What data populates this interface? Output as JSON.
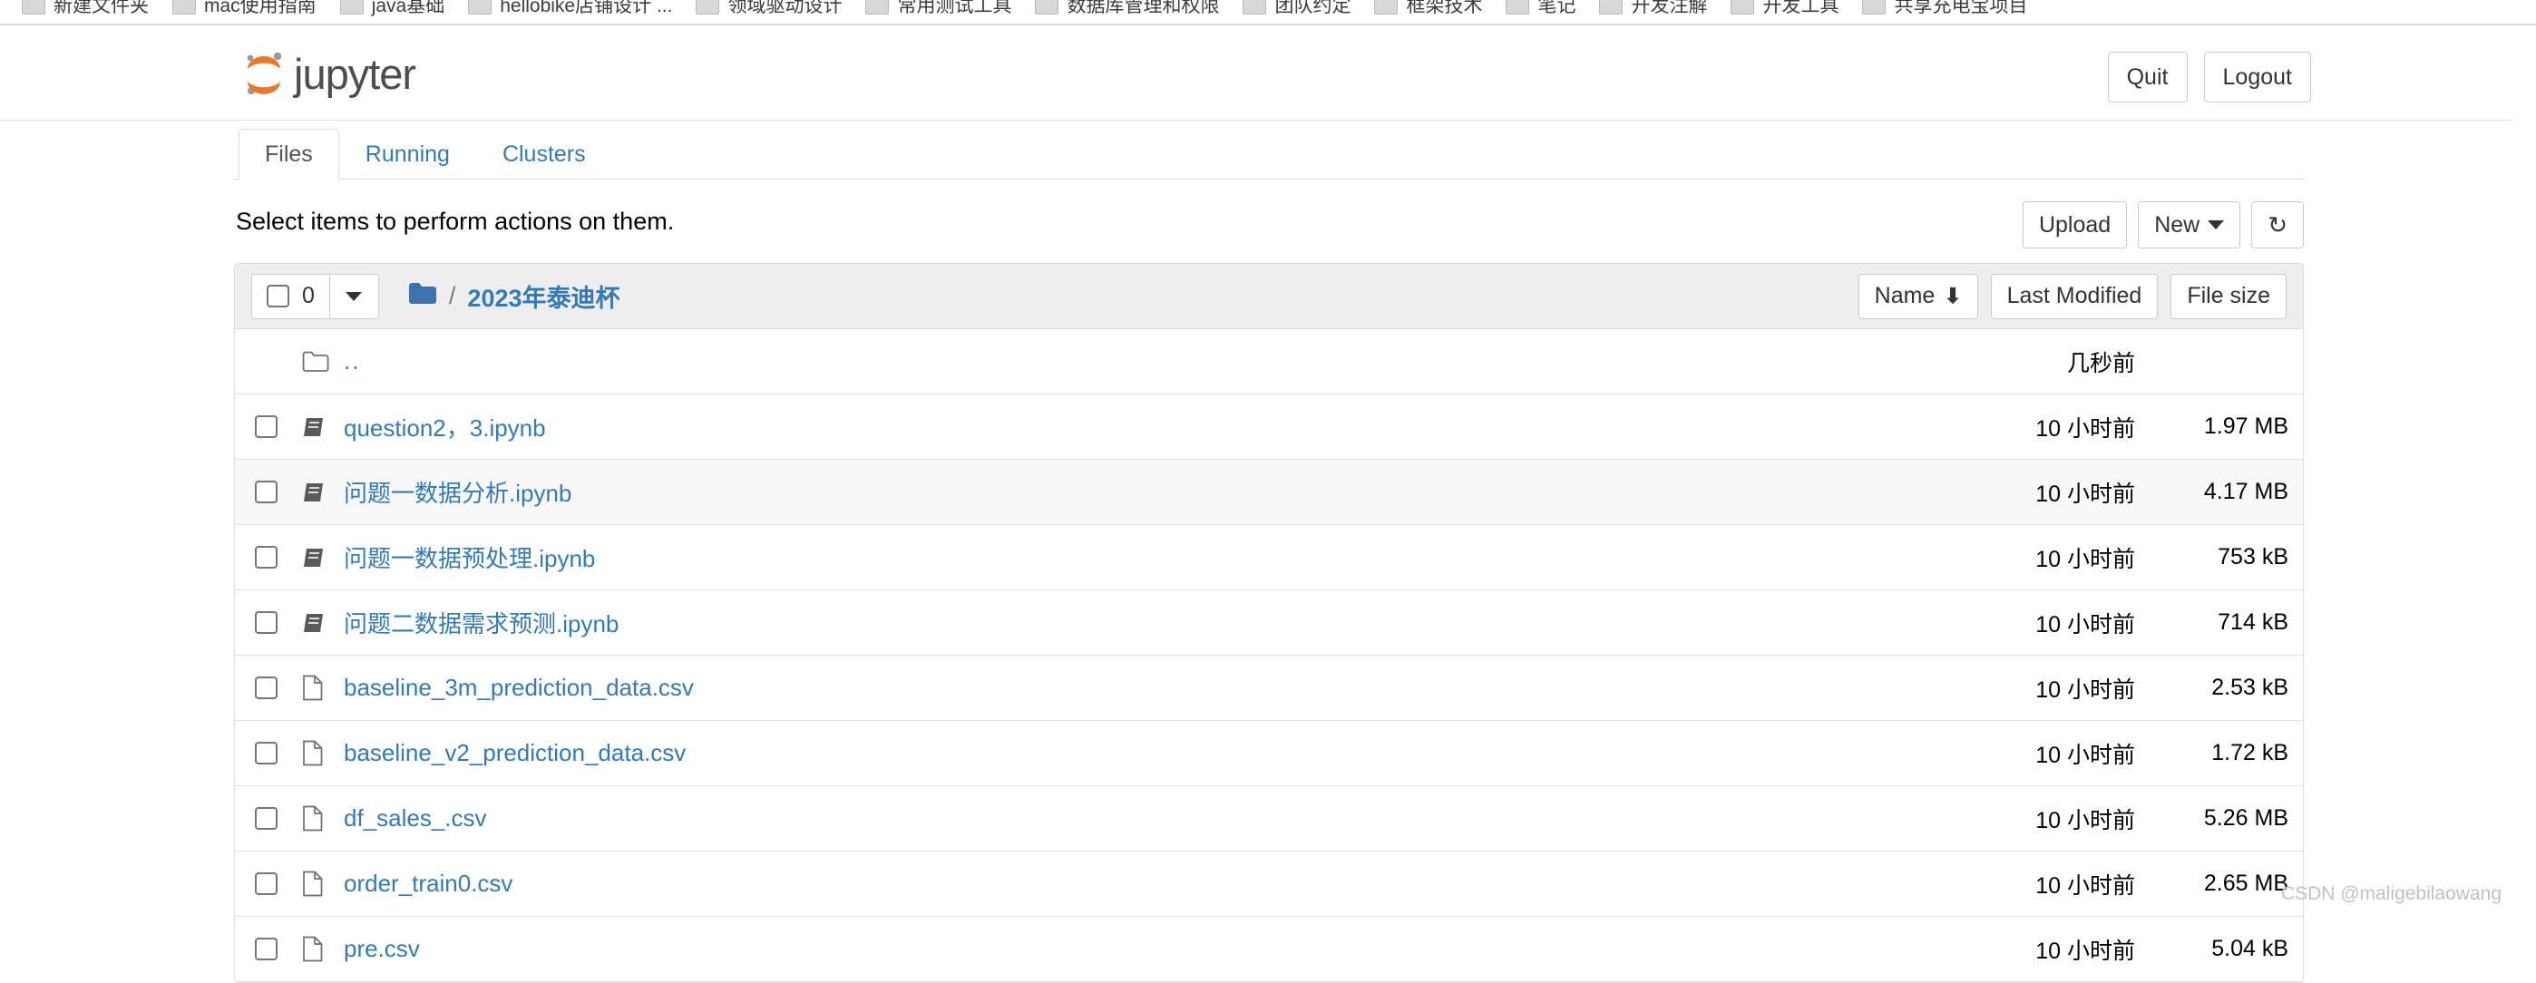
{
  "browser": {
    "bookmarks": [
      {
        "label": "新建文件夹"
      },
      {
        "label": "mac使用指南"
      },
      {
        "label": "java基础"
      },
      {
        "label": "hellobike店铺设计 ..."
      },
      {
        "label": "领域驱动设计"
      },
      {
        "label": "常用测试工具"
      },
      {
        "label": "数据库管理和权限"
      },
      {
        "label": "团队约定"
      },
      {
        "label": "框架技术"
      },
      {
        "label": "笔记"
      },
      {
        "label": "开发注解"
      },
      {
        "label": "开发工具"
      },
      {
        "label": "共享充电宝项目"
      }
    ]
  },
  "header": {
    "logo_text": "jupyter",
    "logo_color": "#e8792a",
    "quit_label": "Quit",
    "logout_label": "Logout"
  },
  "tabs": [
    {
      "label": "Files",
      "active": true
    },
    {
      "label": "Running",
      "active": false
    },
    {
      "label": "Clusters",
      "active": false
    }
  ],
  "toolbar": {
    "message": "Select items to perform actions on them.",
    "upload_label": "Upload",
    "new_label": "New",
    "refresh_icon": "refresh-icon"
  },
  "file_list": {
    "selected_count": "0",
    "breadcrumb": {
      "root_icon": "folder-icon",
      "separator": "/",
      "path": "2023年泰迪杯"
    },
    "sort": {
      "name_label": "Name",
      "name_direction_icon": "arrow-down-icon",
      "last_modified_label": "Last Modified",
      "file_size_label": "File size"
    },
    "rows": [
      {
        "icon": "folder-open-icon",
        "name": "..",
        "last_modified": "几秒前",
        "size": "",
        "checkbox": false,
        "type": "parent"
      },
      {
        "icon": "notebook-icon",
        "name": "question2，3.ipynb",
        "last_modified": "10 小时前",
        "size": "1.97 MB",
        "checkbox": true,
        "type": "notebook"
      },
      {
        "icon": "notebook-icon",
        "name": "问题一数据分析.ipynb",
        "last_modified": "10 小时前",
        "size": "4.17 MB",
        "checkbox": true,
        "type": "notebook"
      },
      {
        "icon": "notebook-icon",
        "name": "问题一数据预处理.ipynb",
        "last_modified": "10 小时前",
        "size": "753 kB",
        "checkbox": true,
        "type": "notebook"
      },
      {
        "icon": "notebook-icon",
        "name": "问题二数据需求预测.ipynb",
        "last_modified": "10 小时前",
        "size": "714 kB",
        "checkbox": true,
        "type": "notebook"
      },
      {
        "icon": "file-icon",
        "name": "baseline_3m_prediction_data.csv",
        "last_modified": "10 小时前",
        "size": "2.53 kB",
        "checkbox": true,
        "type": "file"
      },
      {
        "icon": "file-icon",
        "name": "baseline_v2_prediction_data.csv",
        "last_modified": "10 小时前",
        "size": "1.72 kB",
        "checkbox": true,
        "type": "file"
      },
      {
        "icon": "file-icon",
        "name": "df_sales_.csv",
        "last_modified": "10 小时前",
        "size": "5.26 MB",
        "checkbox": true,
        "type": "file"
      },
      {
        "icon": "file-icon",
        "name": "order_train0.csv",
        "last_modified": "10 小时前",
        "size": "2.65 MB",
        "checkbox": true,
        "type": "file"
      },
      {
        "icon": "file-icon",
        "name": "pre.csv",
        "last_modified": "10 小时前",
        "size": "5.04 kB",
        "checkbox": true,
        "type": "file"
      }
    ]
  },
  "watermark": {
    "text": "CSDN @maligebilaowang"
  }
}
